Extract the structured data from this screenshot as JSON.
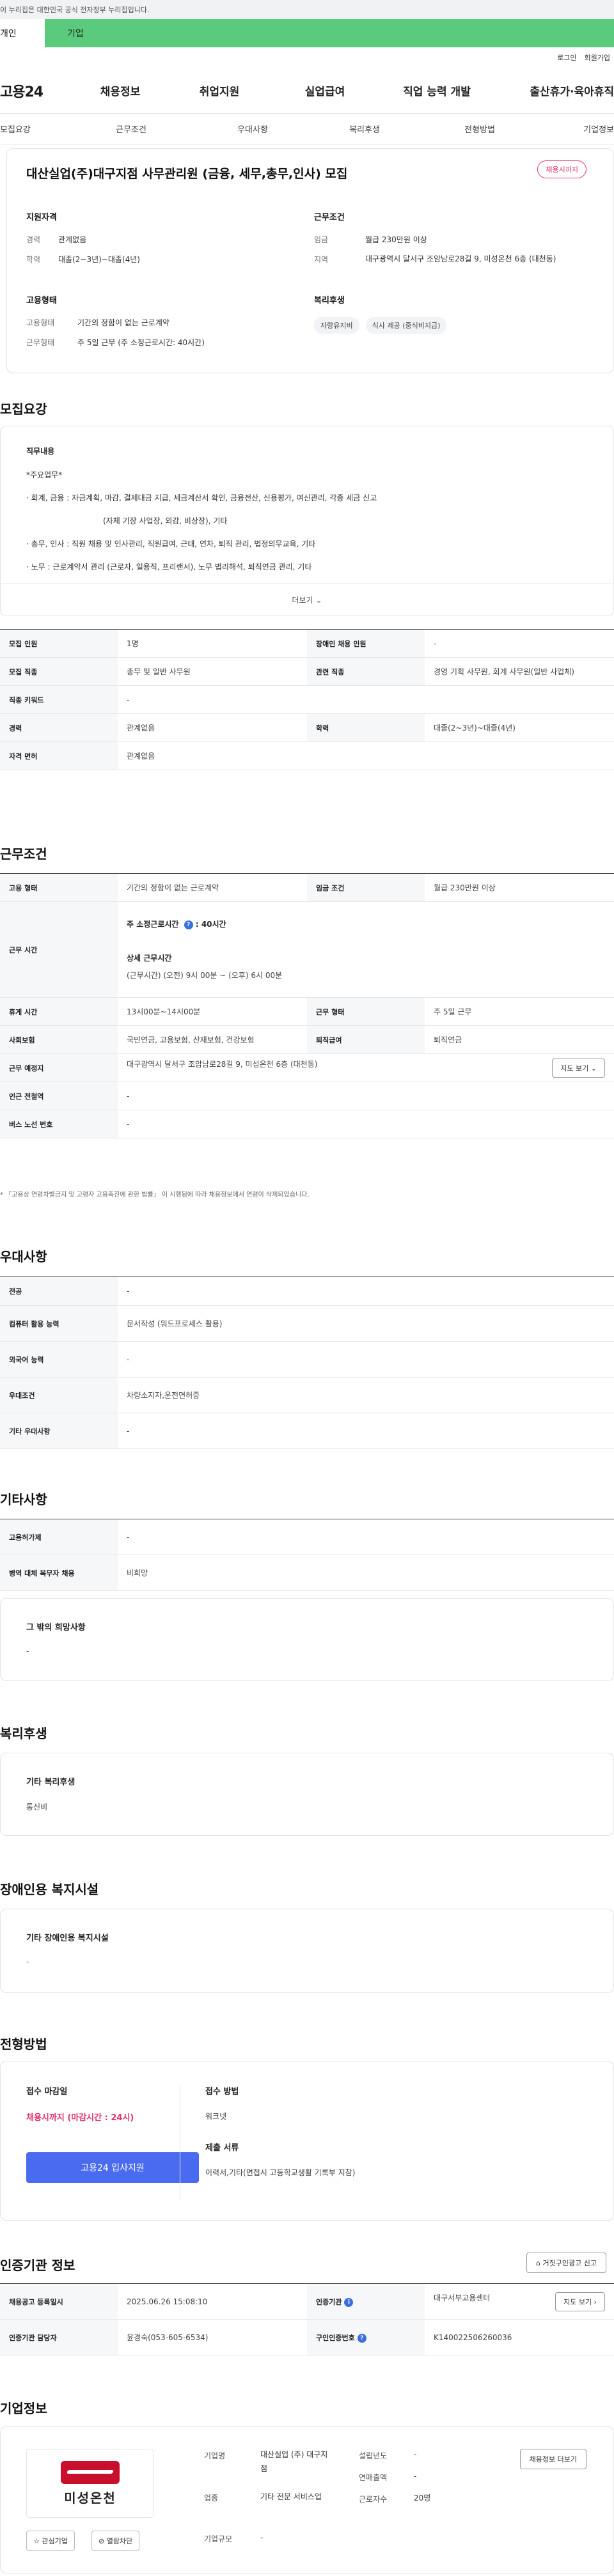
{
  "gov_banner": "이 누리집은 대한민국 공식 전자정부 누리집입니다.",
  "user_tabs": [
    "개인",
    "기업"
  ],
  "util": [
    "로그인",
    "회원가입"
  ],
  "gnb": {
    "logo": "고용24",
    "items": [
      "채용정보",
      "취업지원",
      "실업급여",
      "직업 능력 개발",
      "출산휴가·육아휴직"
    ]
  },
  "sub_tabs": [
    "모집요강",
    "근무조건",
    "우대사항",
    "복리후생",
    "전형방법",
    "기업정보"
  ],
  "summary": {
    "title": "대산실업(주)대구지점 사무관리원 (금융, 세무,총무,인사) 모집",
    "status": "채용시까지",
    "qual_head": "지원자격",
    "qual_rows": [
      {
        "k": "경력",
        "v": "관계없음"
      },
      {
        "k": "학력",
        "v": "대졸(2~3년)~대졸(4년)"
      }
    ],
    "emp_head": "고용형태",
    "emp_rows": [
      {
        "k": "고용형태",
        "v": "기간의 정함이 없는 근로계약"
      },
      {
        "k": "근무형태",
        "v": "주 5일 근무 (주 소정근로시간: 40시간)"
      }
    ],
    "cond_head": "근무조건",
    "cond_rows": [
      {
        "k": "임금",
        "v": "월급 230만원 이상"
      },
      {
        "k": "지역",
        "v": "대구광역시 달서구 조암남로28길 9, 미성온천 6층 (대천동)"
      }
    ],
    "welfare_head": "복리후생",
    "welfare_chips": [
      "자랑유지비",
      "식사 제공 (중식비지급)"
    ]
  },
  "recruit": {
    "title": "모집요강",
    "desc_head": "직무내용",
    "desc_lines": [
      "*주요업무*",
      "· 회계, 금융 : 자금계획, 마감, 결제대금 지급, 세금계산서 확인, 금융전산, 신용평가, 여신관리, 각종 세금 신고",
      "(자체 기장 사업장, 외감, 비상장), 기타",
      "· 총무, 인사 : 직원 채용 및 인사관리,  직원급여, 근태, 연차, 퇴직 관리, 법정의무교육, 기타",
      "· 노무 : 근로계약서 관리 (근로자, 일용직, 프리랜서), 노무 법리해석, 퇴직연금 관리, 기타"
    ],
    "more": "더보기",
    "rows": [
      [
        "모집 인원",
        "1명",
        "장애인 채용 인원",
        "-"
      ],
      [
        "모집 직종",
        "총무 및 일반 사무원",
        "관련 직종",
        "경영 기획 사무원, 회계 사무원(일반 사업체)"
      ],
      [
        "직종 키워드",
        "-",
        "",
        ""
      ],
      [
        "경력",
        "관계없음",
        "학력",
        "대졸(2~3년)~대졸(4년)"
      ],
      [
        "자격 면허",
        "관계없음",
        "",
        ""
      ]
    ]
  },
  "conditions": {
    "title": "근무조건",
    "emp_type_k": "고용 형태",
    "emp_type_v": "기간의 정함이 없는 근로계약",
    "wage_k": "임금 조건",
    "wage_v": "월급 230만원 이상",
    "hours_k": "근무 시간",
    "hours_weekly": "주 소정근로시간",
    "hours_weekly_val": ": 40시간",
    "hours_detail_head": "상세 근무시간",
    "hours_detail": "(근무시간) (오전) 9시 00분 ~ (오후) 6시 00분",
    "break_k": "휴게 시간",
    "break_v": "13시00분~14시00분",
    "shift_k": "근무 형태",
    "shift_v": "주 5일 근무",
    "ins_k": "사회보험",
    "ins_v": "국민연금, 고용보험, 산재보험, 건강보험",
    "retire_k": "퇴직급여",
    "retire_v": "퇴직연금",
    "place_k": "근무 예정지",
    "place_v": "대구광역시 달서구 조암남로28길 9, 미성온천 6층 (대천동)",
    "map_btn": "지도 보기",
    "subway_k": "인근 전철역",
    "subway_v": "-",
    "bus_k": "버스 노선 번호",
    "bus_v": "-",
    "note": "* 「고용상 연령차별금지 및 고령자 고용촉진에 관한 법률」 이 시행됨에 따라 채용정보에서 연령이 삭제되었습니다."
  },
  "prefer": {
    "title": "우대사항",
    "rows": [
      [
        "전공",
        "-"
      ],
      [
        "컴퓨터 활용 능력",
        "문서작성 (워드프로세스 활용)"
      ],
      [
        "외국어 능력",
        "-"
      ],
      [
        "우대조건",
        "차량소지자,운전면허증"
      ],
      [
        "기타 우대사항",
        "-"
      ]
    ]
  },
  "etc": {
    "title": "기타사항",
    "rows": [
      [
        "고용허가제",
        "-"
      ],
      [
        "병역 대체 복무자 채용",
        "비희망"
      ]
    ],
    "other_head": "그 밖의 희망사항",
    "other_val": "-"
  },
  "welfare": {
    "title": "복리후생",
    "head": "기타 복리후생",
    "val": "통신비"
  },
  "disability": {
    "title": "장애인용 복지시설",
    "head": "기타 장애인용 복지시설",
    "val": "-"
  },
  "apply": {
    "title": "전형방법",
    "deadline_head": "접수 마감일",
    "deadline_val": "채용시까지 (마감시간 : 24시)",
    "apply_btn": "고용24 입사지원",
    "method_head": "접수 방법",
    "method_val": "워크넷",
    "docs_head": "제출 서류",
    "docs_val": "이력서,기타(면접시 고등학교생활 기록부 지참)"
  },
  "agency": {
    "title": "인증기관 정보",
    "report_btn": "거짓구인광고 신고",
    "reg_k": "채용공고 등록일시",
    "reg_v": "2025.06.26 15:08:10",
    "org_k": "인증기관",
    "org_v": "대구서부고용센터",
    "map_btn": "지도 보기",
    "staff_k": "인증기관 담당자",
    "staff_v": "윤경숙(053-605-6534)",
    "no_k": "구인인증번호",
    "no_v": "K140022506260036"
  },
  "company": {
    "title": "기업정보",
    "logo_text": "미성온천",
    "fav_btn": "관심기업",
    "block_btn": "열람차단",
    "detail_btn": "채용정보 더보기",
    "name_k": "기업명",
    "name_v": "대산실업 (주) 대구지점",
    "industry_k": "업종",
    "industry_v": "기타 전문 서비스업",
    "size_k": "기업규모",
    "size_v": "-",
    "founded_k": "설립년도",
    "founded_v": "-",
    "sales_k": "연매출액",
    "sales_v": "-",
    "workers_k": "근로자수",
    "workers_v": "20명"
  }
}
